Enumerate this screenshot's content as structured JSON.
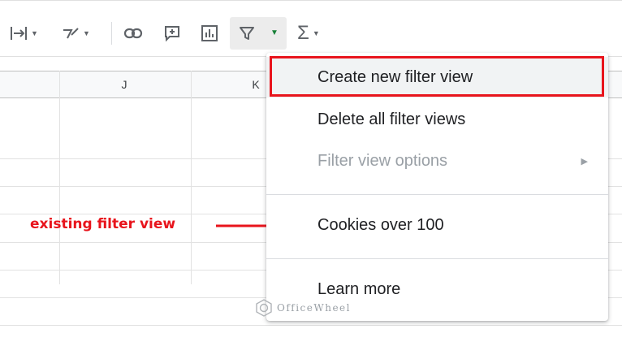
{
  "toolbar": {
    "icons": [
      {
        "name": "text-wrap-icon",
        "glyph": "|→"
      },
      {
        "name": "text-rotation-icon",
        "glyph": "⧸"
      },
      {
        "name": "insert-link-icon",
        "glyph": "⊂⊃"
      },
      {
        "name": "insert-comment-icon",
        "glyph": "⊞"
      },
      {
        "name": "insert-chart-icon",
        "glyph": "▥"
      },
      {
        "name": "filter-icon",
        "glyph": "Y"
      },
      {
        "name": "functions-icon",
        "glyph": "Σ"
      }
    ]
  },
  "grid": {
    "columns": [
      "J",
      "K"
    ]
  },
  "menu": {
    "items": [
      {
        "label": "Create new filter view",
        "disabled": false
      },
      {
        "label": "Delete all filter views",
        "disabled": false
      },
      {
        "label": "Filter view options",
        "disabled": true,
        "submenu": true
      },
      {
        "label": "Cookies over 100",
        "disabled": false
      },
      {
        "label": "Learn more",
        "disabled": false
      }
    ],
    "submenu_arrow": "▶"
  },
  "annotation": {
    "text": "existing filter view",
    "color": "#e8141c"
  },
  "watermark": {
    "text": "OfficeWheel"
  },
  "colors": {
    "filter_caret": "#188038",
    "highlight": "#e8141c"
  }
}
